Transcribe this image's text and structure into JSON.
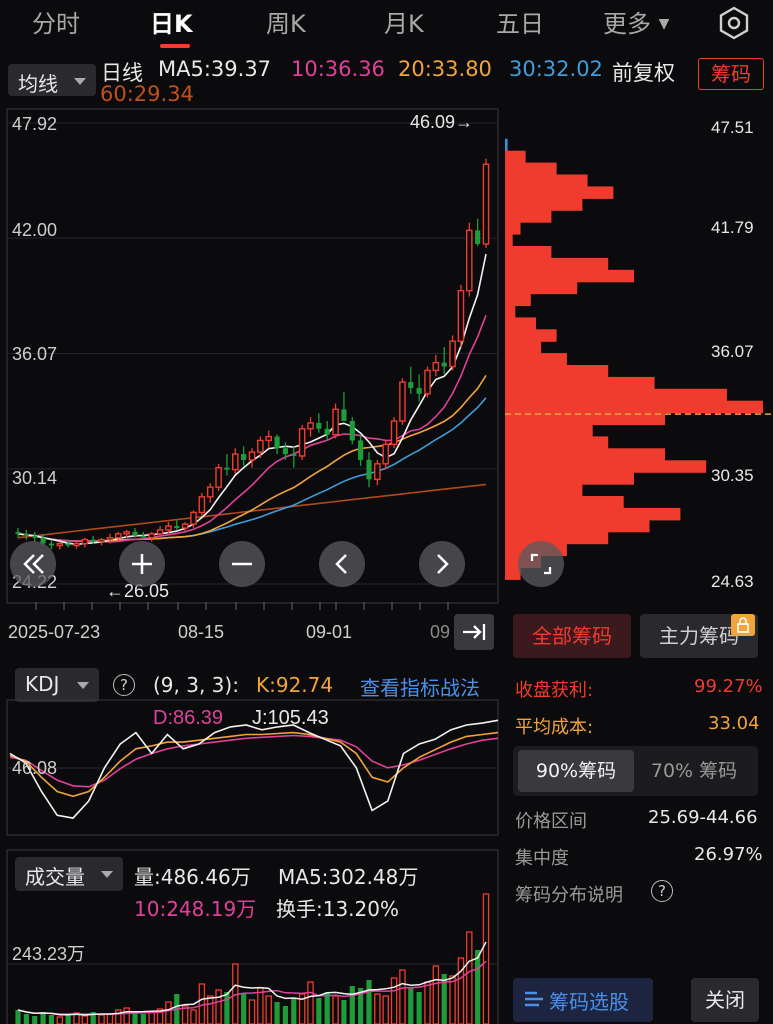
{
  "tabs": [
    {
      "label": "分时"
    },
    {
      "label": "日K"
    },
    {
      "label": "周K"
    },
    {
      "label": "月K"
    },
    {
      "label": "五日"
    },
    {
      "label": "更多"
    }
  ],
  "ma": {
    "selector": "均线",
    "period": "日线",
    "ma5": "MA5:39.37",
    "ma10": "10:36.36",
    "ma20": "20:33.80",
    "ma30": "30:32.02",
    "ma60": "60:29.34",
    "adjust": "前复权",
    "chip_button": "筹码"
  },
  "colors": {
    "red": "#f03c2e",
    "green": "#1f9b3a",
    "ma5": "#f2f2f2",
    "ma10": "#e0409a",
    "ma20": "#f2a43a",
    "ma30": "#3f9ddc",
    "ma60": "#b04a1c",
    "accent_blue": "#4a8fe8"
  },
  "kline": {
    "y_labels": [
      "47.92",
      "42.00",
      "36.07",
      "30.14",
      "24.22"
    ],
    "high_marker": "46.09→",
    "low_marker": "←26.05",
    "dates": [
      "2025-07-23",
      "08-15",
      "09-01",
      "09"
    ]
  },
  "chip_axis": [
    "47.51",
    "41.79",
    "36.07",
    "30.35",
    "24.63"
  ],
  "chips": {
    "tab_all": "全部筹码",
    "tab_main": "主力筹码",
    "profit_label": "收盘获利:",
    "profit_value": "99.27%",
    "avgcost_label": "平均成本:",
    "avgcost_value": "33.04",
    "tab_90": "90%筹码",
    "tab_70": "70% 筹码",
    "range_label": "价格区间",
    "range_value": "25.69-44.66",
    "conc_label": "集中度",
    "conc_value": "26.97%",
    "explain_label": "筹码分布说明",
    "select_button": "筹码选股",
    "close_button": "关闭"
  },
  "kdj": {
    "selector": "KDJ",
    "params": "(9, 3, 3):",
    "k": "K:92.74",
    "d": "D:86.39",
    "j": "J:105.43",
    "link": "查看指标战法",
    "y_label": "46.08"
  },
  "volume": {
    "selector": "成交量",
    "vol": "量:486.46万",
    "ma5": "MA5:302.48万",
    "ma10": "10:248.19万",
    "turnover": "换手:13.20%",
    "y_label": "243.23万"
  },
  "chart_data": [
    {
      "type": "candlestick",
      "title": "日K",
      "x_labels": [
        "2025-07-23",
        "08-15",
        "09-01"
      ],
      "y_ticks": [
        47.92,
        42.0,
        36.07,
        30.14,
        24.22
      ],
      "ylim": [
        24.22,
        47.92
      ],
      "high": 46.09,
      "low": 26.05,
      "ohlc": [
        [
          26.9,
          27.1,
          26.6,
          26.8
        ],
        [
          26.8,
          27.0,
          26.5,
          26.7
        ],
        [
          26.7,
          26.9,
          26.4,
          26.6
        ],
        [
          26.6,
          26.8,
          26.2,
          26.3
        ],
        [
          26.3,
          26.5,
          26.0,
          26.2
        ],
        [
          26.2,
          26.4,
          26.0,
          26.3
        ],
        [
          26.3,
          26.5,
          26.1,
          26.2
        ],
        [
          26.2,
          26.4,
          26.05,
          26.3
        ],
        [
          26.3,
          26.6,
          26.1,
          26.5
        ],
        [
          26.5,
          26.7,
          26.3,
          26.4
        ],
        [
          26.4,
          26.6,
          26.2,
          26.5
        ],
        [
          26.5,
          26.8,
          26.3,
          26.6
        ],
        [
          26.6,
          26.9,
          26.4,
          26.8
        ],
        [
          26.8,
          27.0,
          26.6,
          26.9
        ],
        [
          26.9,
          27.1,
          26.6,
          26.7
        ],
        [
          26.7,
          26.9,
          26.5,
          26.6
        ],
        [
          26.6,
          26.9,
          26.4,
          26.8
        ],
        [
          26.8,
          27.2,
          26.6,
          27.0
        ],
        [
          27.0,
          27.4,
          26.8,
          27.2
        ],
        [
          27.2,
          27.5,
          27.0,
          27.1
        ],
        [
          27.1,
          27.4,
          26.9,
          27.3
        ],
        [
          27.3,
          28.0,
          27.1,
          27.9
        ],
        [
          27.9,
          28.9,
          27.7,
          28.7
        ],
        [
          28.7,
          29.4,
          28.4,
          29.2
        ],
        [
          29.2,
          30.4,
          29.0,
          30.2
        ],
        [
          30.2,
          30.9,
          29.8,
          30.1
        ],
        [
          30.1,
          31.2,
          29.9,
          30.9
        ],
        [
          30.9,
          31.3,
          30.3,
          30.6
        ],
        [
          30.6,
          31.2,
          30.2,
          31.0
        ],
        [
          31.0,
          31.8,
          30.7,
          31.6
        ],
        [
          31.6,
          32.1,
          31.2,
          31.8
        ],
        [
          31.8,
          31.9,
          30.9,
          31.2
        ],
        [
          31.2,
          31.5,
          30.6,
          30.9
        ],
        [
          30.9,
          31.3,
          30.2,
          30.8
        ],
        [
          30.8,
          32.4,
          30.6,
          32.2
        ],
        [
          32.2,
          32.8,
          31.8,
          32.5
        ],
        [
          32.5,
          33.0,
          32.0,
          32.2
        ],
        [
          32.2,
          32.6,
          31.6,
          31.9
        ],
        [
          31.9,
          33.5,
          31.7,
          33.2
        ],
        [
          33.2,
          34.1,
          32.8,
          32.6
        ],
        [
          32.6,
          32.8,
          31.4,
          31.6
        ],
        [
          31.6,
          31.9,
          30.3,
          30.6
        ],
        [
          30.6,
          31.0,
          29.2,
          29.6
        ],
        [
          29.6,
          30.6,
          29.3,
          30.4
        ],
        [
          30.4,
          31.6,
          30.1,
          31.4
        ],
        [
          31.4,
          32.8,
          31.2,
          32.6
        ],
        [
          32.6,
          34.8,
          32.4,
          34.6
        ],
        [
          34.6,
          35.4,
          34.0,
          34.3
        ],
        [
          34.3,
          35.0,
          33.6,
          34.0
        ],
        [
          34.0,
          35.4,
          33.8,
          35.2
        ],
        [
          35.2,
          36.0,
          34.9,
          35.6
        ],
        [
          35.6,
          36.4,
          35.0,
          35.4
        ],
        [
          35.4,
          37.0,
          35.2,
          36.7
        ],
        [
          36.7,
          39.6,
          36.4,
          39.3
        ],
        [
          39.3,
          42.8,
          39.0,
          42.4
        ],
        [
          42.4,
          43.0,
          41.6,
          41.7
        ],
        [
          41.7,
          46.09,
          41.5,
          45.8
        ]
      ],
      "ma": {
        "MA5": 39.37,
        "MA10": 36.36,
        "MA20": 33.8,
        "MA30": 32.02,
        "MA60": 29.34
      }
    },
    {
      "type": "histogram",
      "title": "筹码分布",
      "y_ticks": [
        47.51,
        41.79,
        36.07,
        30.35,
        24.63
      ],
      "average_cost": 33.04,
      "profit_ratio": "99.27%",
      "price_range": [
        25.69,
        44.66
      ],
      "concentration": "26.97%",
      "profile": [
        [
          46.6,
          0.01
        ],
        [
          46.0,
          0.08
        ],
        [
          45.4,
          0.2
        ],
        [
          44.8,
          0.32
        ],
        [
          44.2,
          0.42
        ],
        [
          43.6,
          0.3
        ],
        [
          43.0,
          0.18
        ],
        [
          42.4,
          0.06
        ],
        [
          41.8,
          0.03
        ],
        [
          41.2,
          0.18
        ],
        [
          40.6,
          0.4
        ],
        [
          40.0,
          0.5
        ],
        [
          39.4,
          0.28
        ],
        [
          38.8,
          0.1
        ],
        [
          38.2,
          0.04
        ],
        [
          37.6,
          0.12
        ],
        [
          37.0,
          0.2
        ],
        [
          36.4,
          0.14
        ],
        [
          35.8,
          0.24
        ],
        [
          35.2,
          0.4
        ],
        [
          34.6,
          0.58
        ],
        [
          34.0,
          0.86
        ],
        [
          33.4,
          1.0
        ],
        [
          32.8,
          0.62
        ],
        [
          32.2,
          0.34
        ],
        [
          31.6,
          0.4
        ],
        [
          31.0,
          0.62
        ],
        [
          30.4,
          0.78
        ],
        [
          29.8,
          0.5
        ],
        [
          29.2,
          0.3
        ],
        [
          28.6,
          0.46
        ],
        [
          28.0,
          0.68
        ],
        [
          27.4,
          0.56
        ],
        [
          26.8,
          0.4
        ],
        [
          26.2,
          0.24
        ],
        [
          25.6,
          0.14
        ],
        [
          25.0,
          0.06
        ]
      ]
    },
    {
      "type": "line",
      "title": "KDJ",
      "params": [
        9,
        3,
        3
      ],
      "y_ticks": [
        46.08
      ],
      "series": [
        {
          "name": "K",
          "last": 92.74
        },
        {
          "name": "D",
          "last": 86.39
        },
        {
          "name": "J",
          "last": 105.43
        }
      ]
    },
    {
      "type": "bar",
      "title": "成交量",
      "y_ticks": [
        "243.23万"
      ],
      "last_volume": "486.46万",
      "MA5": "302.48万",
      "MA10": "248.19万",
      "turnover": "13.20%"
    }
  ]
}
